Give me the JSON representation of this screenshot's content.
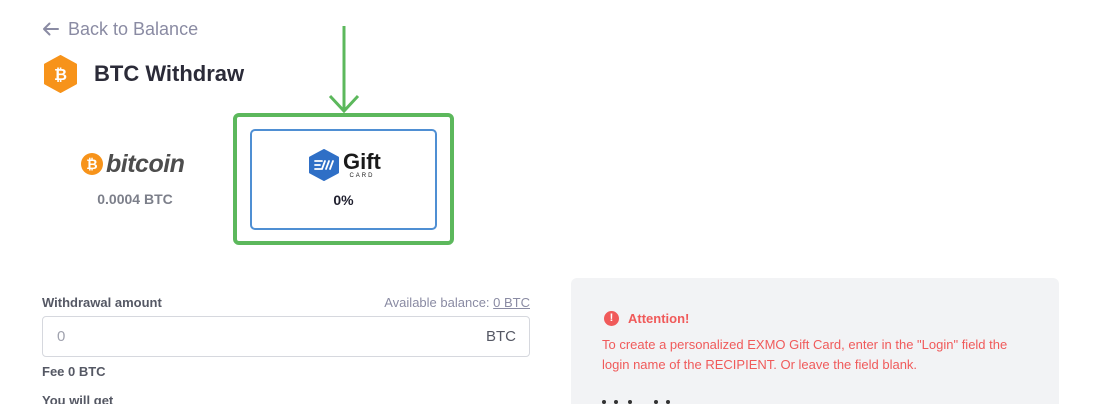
{
  "nav": {
    "back_label": "Back to Balance"
  },
  "header": {
    "title": "BTC Withdraw",
    "coin_symbol": "₿"
  },
  "methods": [
    {
      "name": "bitcoin",
      "logo_text": "bitcoin",
      "logo_symbol": "₿",
      "fee": "0.0004 BTC",
      "selected": false
    },
    {
      "name": "gift-card",
      "logo_text": "Gift",
      "logo_subtext": "CARD",
      "fee": "0%",
      "selected": true
    }
  ],
  "form": {
    "amount_label": "Withdrawal amount",
    "available_prefix": "Available balance: ",
    "available_value": "0 BTC",
    "amount_placeholder": "0",
    "amount_currency": "BTC",
    "fee": "Fee 0 BTC",
    "you_will_get_label": "You will get"
  },
  "attention": {
    "icon": "!",
    "title": "Attention!",
    "body": "To create a personalized EXMO Gift Card, enter in the \"Login\" field the login name of the RECIPIENT. Or leave the field blank."
  },
  "colors": {
    "accent_orange": "#f7931a",
    "highlight_green": "#5cb85c",
    "selected_blue": "#4f8fd3",
    "warning_red": "#f05a5a",
    "exmo_blue": "#2f6fc6"
  }
}
